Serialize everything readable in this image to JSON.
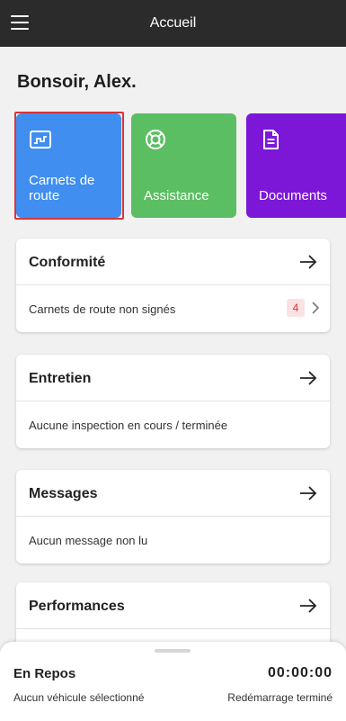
{
  "header": {
    "title": "Accueil",
    "menu_icon": "hamburger-menu-icon"
  },
  "greeting": "Bonsoir, Alex.",
  "tiles": [
    {
      "label": "Carnets de route",
      "icon": "logbook-chart-icon",
      "color": "#3f8ef0"
    },
    {
      "label": "Assistance",
      "icon": "lifebuoy-icon",
      "color": "#5cbe62"
    },
    {
      "label": "Documents",
      "icon": "document-icon",
      "color": "#7c17d8"
    }
  ],
  "cards": {
    "compliance": {
      "title": "Conformité",
      "row": "Carnets de route non signés",
      "badge": "4"
    },
    "maintenance": {
      "title": "Entretien",
      "row": "Aucune inspection en cours / terminée"
    },
    "messages": {
      "title": "Messages",
      "row": "Aucun message non lu"
    },
    "performance": {
      "title": "Performances"
    }
  },
  "status": {
    "title": "En Repos",
    "timer": "00:00:00",
    "vehicle": "Aucun véhicule sélectionné",
    "restart": "Redémarrage terminé"
  },
  "colors": {
    "accent_red": "#d9343a",
    "topbar": "#2b2b2b"
  }
}
